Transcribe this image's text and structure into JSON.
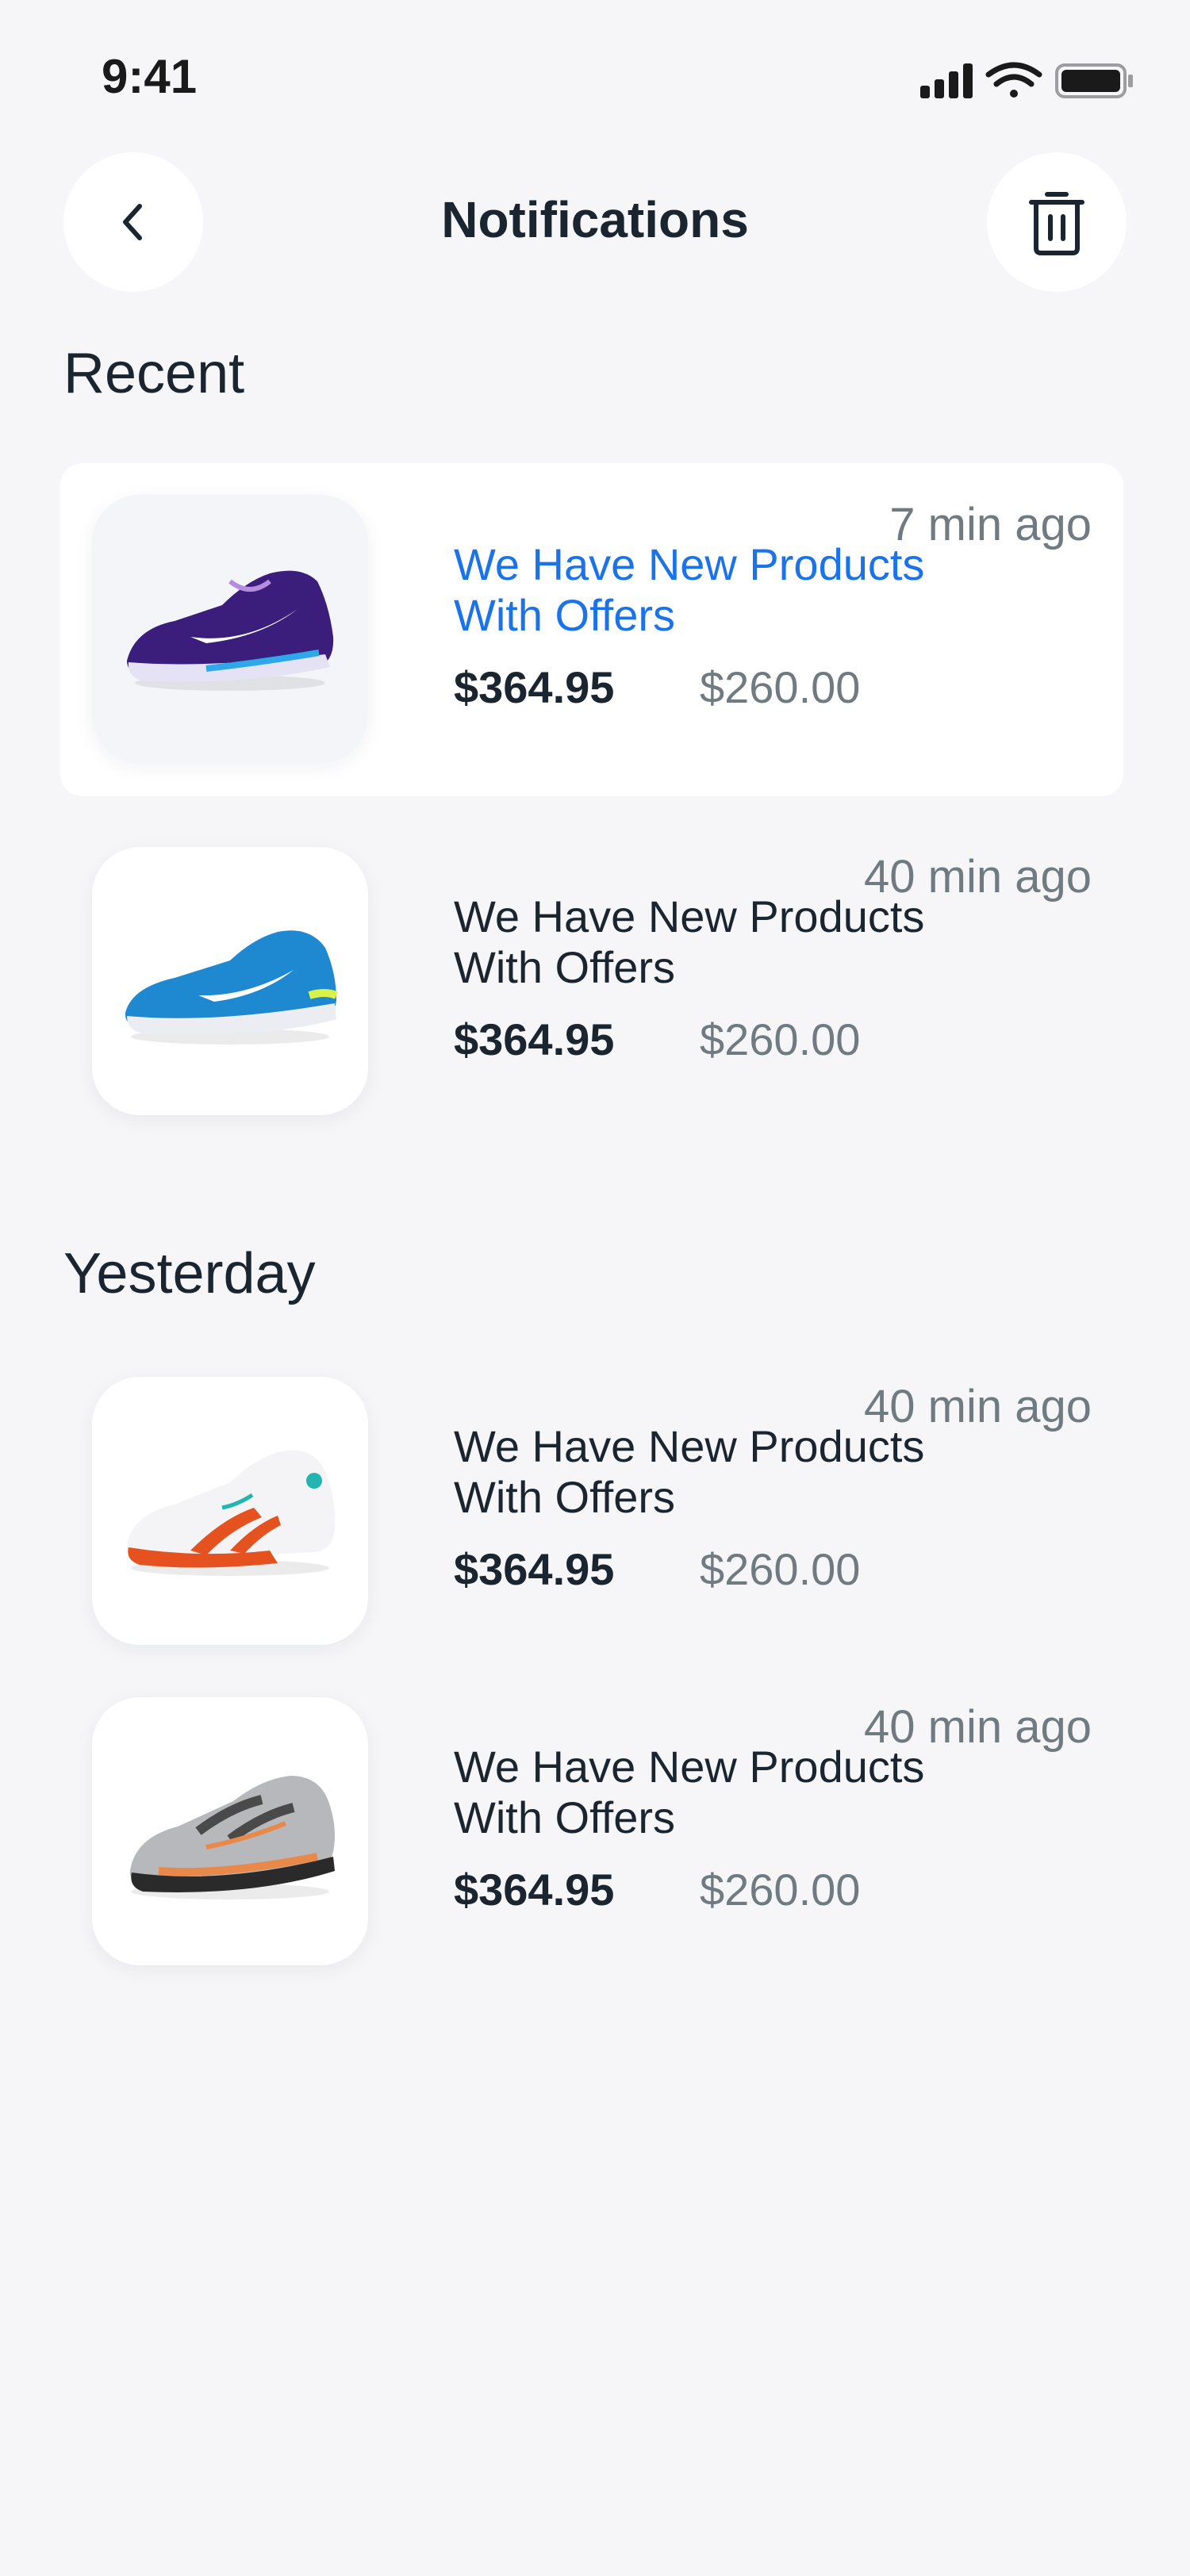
{
  "status_bar": {
    "time": "9:41"
  },
  "header": {
    "title": "Notifications"
  },
  "sections": {
    "recent": {
      "title": "Recent"
    },
    "yesterday": {
      "title": "Yesterday"
    }
  },
  "notifications": [
    {
      "time": "7 min ago",
      "title": "We Have New Products With Offers",
      "price": "$364.95",
      "old_price": "$260.00",
      "image": "purple-sneaker",
      "highlighted": true
    },
    {
      "time": "40 min ago",
      "title": "We Have New Products With Offers",
      "price": "$364.95",
      "old_price": "$260.00",
      "image": "blue-sneaker",
      "highlighted": false
    },
    {
      "time": "40 min ago",
      "title": "We Have New Products With Offers",
      "price": "$364.95",
      "old_price": "$260.00",
      "image": "orange-white-sneaker",
      "highlighted": false
    },
    {
      "time": "40 min ago",
      "title": "We Have New Products With Offers",
      "price": "$364.95",
      "old_price": "$260.00",
      "image": "grey-orange-sneaker",
      "highlighted": false
    }
  ],
  "colors": {
    "background": "#F6F6F8",
    "accent": "#1A73E8",
    "text": "#1A2530",
    "muted": "#707B81"
  }
}
